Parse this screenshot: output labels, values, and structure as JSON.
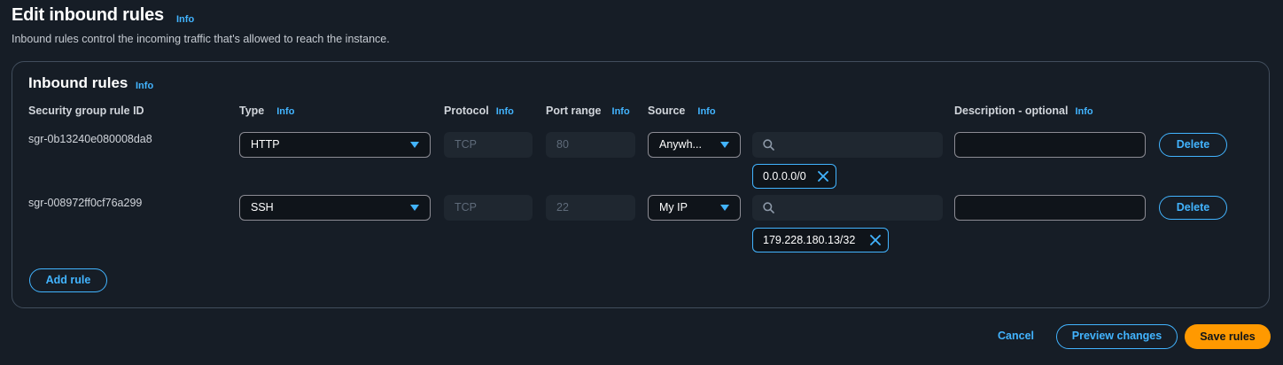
{
  "page": {
    "title": "Edit inbound rules",
    "title_info": "Info",
    "description": "Inbound rules control the incoming traffic that's allowed to reach the instance."
  },
  "panel": {
    "title": "Inbound rules",
    "title_info": "Info",
    "columns": {
      "rule_id": "Security group rule ID",
      "type": "Type",
      "type_info": "Info",
      "protocol": "Protocol",
      "protocol_info": "Info",
      "port_range": "Port range",
      "port_range_info": "Info",
      "source": "Source",
      "source_info": "Info",
      "description": "Description - optional",
      "description_info": "Info"
    },
    "rules": [
      {
        "id": "sgr-0b13240e080008da8",
        "type": "HTTP",
        "protocol": "TCP",
        "port_range": "80",
        "source": "Anywh...",
        "source_search": "",
        "cidr": "0.0.0.0/0",
        "description": "",
        "delete_label": "Delete"
      },
      {
        "id": "sgr-008972ff0cf76a299",
        "type": "SSH",
        "protocol": "TCP",
        "port_range": "22",
        "source": "My IP",
        "source_search": "",
        "cidr": "179.228.180.13/32",
        "description": "",
        "delete_label": "Delete"
      }
    ],
    "add_rule_label": "Add rule"
  },
  "footer": {
    "cancel_label": "Cancel",
    "preview_label": "Preview changes",
    "save_label": "Save rules"
  },
  "colors": {
    "accent": "#42b4ff",
    "primary_button": "#ff9900",
    "background": "#161d26"
  }
}
